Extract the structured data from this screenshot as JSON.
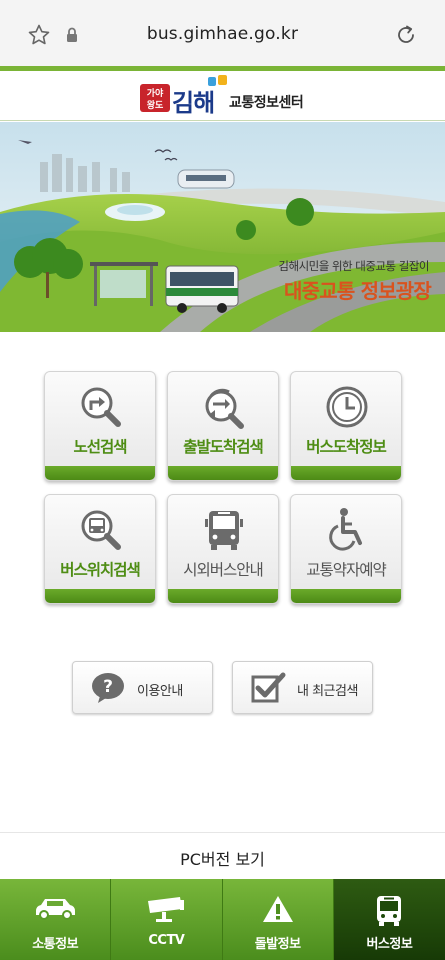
{
  "browser": {
    "url": "bus.gimhae.go.kr"
  },
  "logo": {
    "badge_text": "가야왕도",
    "name": "김해",
    "subtitle": "교통정보센터"
  },
  "banner": {
    "subtitle": "김해시민을 위한 대중교통 길잡이",
    "title": "대중교통 정보광장"
  },
  "menu": [
    {
      "label": "노선검색",
      "icon": "route-search-icon"
    },
    {
      "label": "출발도착검색",
      "icon": "departure-arrival-search-icon"
    },
    {
      "label": "버스도착정보",
      "icon": "clock-icon"
    },
    {
      "label": "버스위치검색",
      "icon": "bus-location-search-icon"
    },
    {
      "label": "시외버스안내",
      "icon": "intercity-bus-icon"
    },
    {
      "label": "교통약자예약",
      "icon": "wheelchair-icon"
    }
  ],
  "small_buttons": [
    {
      "label": "이용안내",
      "icon": "question-icon"
    },
    {
      "label": "내 최근검색",
      "icon": "checkbox-icon"
    }
  ],
  "pc_version": "PC버전 보기",
  "tabs": [
    {
      "label": "소통정보",
      "icon": "car-icon"
    },
    {
      "label": "CCTV",
      "icon": "cctv-icon"
    },
    {
      "label": "돌발정보",
      "icon": "warning-icon"
    },
    {
      "label": "버스정보",
      "icon": "bus-icon"
    }
  ],
  "colors": {
    "accent_green": "#7ab436",
    "banner_title": "#d9531e",
    "active_tab": "#1f4a0b"
  }
}
